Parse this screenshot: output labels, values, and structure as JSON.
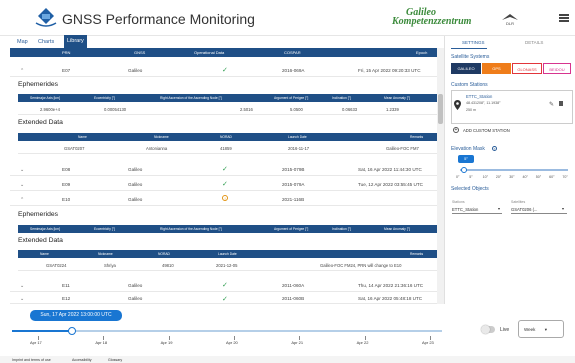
{
  "header": {
    "title": "GNSS Performance Monitoring",
    "partner_line1": "Galileo",
    "partner_line2": "Kompetenzzentrum",
    "partner_logo": "DLR"
  },
  "tabs": [
    "Map",
    "Charts",
    "Library"
  ],
  "table": {
    "columns": [
      "PRN",
      "GNSS",
      "Operational Data",
      "COSPAR",
      "Epoch"
    ],
    "rows": [
      {
        "prn": "E07",
        "gnss": "Galileo",
        "cospar": "2016-069A",
        "epoch": "Fri, 15 Apr 2022 09:20:33 UTC",
        "status": "ok",
        "expanded": true
      },
      {
        "prn": "E08",
        "gnss": "Galileo",
        "cospar": "2015-079B",
        "epoch": "Sat, 16 Apr 2022 11:44:30 UTC",
        "status": "ok"
      },
      {
        "prn": "E09",
        "gnss": "Galileo",
        "cospar": "2015-079A",
        "epoch": "Tue, 12 Apr 2022 03:55:45 UTC",
        "status": "ok"
      },
      {
        "prn": "E10",
        "gnss": "Galileo",
        "cospar": "2021-116B",
        "epoch": "",
        "status": "warn",
        "expanded": true
      },
      {
        "prn": "E11",
        "gnss": "Galileo",
        "cospar": "2011-060A",
        "epoch": "Thu, 14 Apr 2022 21:36:16 UTC",
        "status": "ok"
      },
      {
        "prn": "E12",
        "gnss": "Galileo",
        "cospar": "2011-060B",
        "epoch": "Sat, 16 Apr 2022 05:48:18 UTC",
        "status": "ok"
      }
    ]
  },
  "ephemerides": {
    "title": "Ephemerides",
    "columns": [
      "Semimajor Axis [km]",
      "Eccentricity [°]",
      "Right Ascension of the Ascending Node [°]",
      "Argument of Perigee [°]",
      "Inclination [°]",
      "Mean Anomaly [°]"
    ],
    "values": [
      "2.9600e+4",
      "0.00054130",
      "2.5016",
      "5.0500",
      "0.06633",
      "1.2339"
    ]
  },
  "extended": {
    "title": "Extended Data",
    "columns": [
      "Name",
      "Nickname",
      "NORAD",
      "Launch Date",
      "Remarks"
    ],
    "row1": [
      "GSAT0207",
      "Antonianna",
      "41859",
      "2016-11-17",
      "Galileo-FOC FM7"
    ],
    "row2": [
      "GSAT0224",
      "Shriya",
      "49810",
      "2021-12-05",
      "Galileo-FOC FM24, PRN will change to E10"
    ]
  },
  "right": {
    "tabs": [
      "SETTINGS",
      "DETAILS"
    ],
    "systems_label": "Satellite Systems",
    "systems": [
      {
        "label": "GALILEO",
        "bg": "#1f3a63",
        "fg": "#ffffff"
      },
      {
        "label": "GPS",
        "bg": "#ef7d1a",
        "fg": "#ffffff"
      },
      {
        "label": "GLONASS",
        "bg": "#ffffff",
        "fg": "#e2353b"
      },
      {
        "label": "BEIDOU",
        "bg": "#ffffff",
        "fg": "#d7348f"
      }
    ],
    "stations_label": "Custom Stations",
    "station_name": "ETTC_Station",
    "station_coords": "48.431208°, 11.1938°",
    "station_alt": "250 m",
    "add_station": "ADD CUSTOM STATION",
    "elevation_label": "Elevation Mask",
    "elevation_value": "5°",
    "elevation_ticks": [
      "0°",
      "5°",
      "10°",
      "20°",
      "30°",
      "40°",
      "50°",
      "60°",
      "70°"
    ],
    "selected_label": "Selected Objects",
    "station_field_label": "Stations",
    "station_field_value": "ETTC_Station",
    "satellite_field_label": "Satellites",
    "satellite_field_value": "GSAT0206 (..."
  },
  "timeline": {
    "current": "Sun, 17 Apr 2022 13:00:00 UTC",
    "progress": 0.14,
    "labels": [
      "Apr 17",
      "Apr 18",
      "Apr 19",
      "Apr 20",
      "Apr 21",
      "Apr 22",
      "Apr 23"
    ],
    "live_label": "Live",
    "range": "Week"
  },
  "footer": [
    "Imprint and terms of use",
    "Accessibility",
    "Glossary"
  ]
}
